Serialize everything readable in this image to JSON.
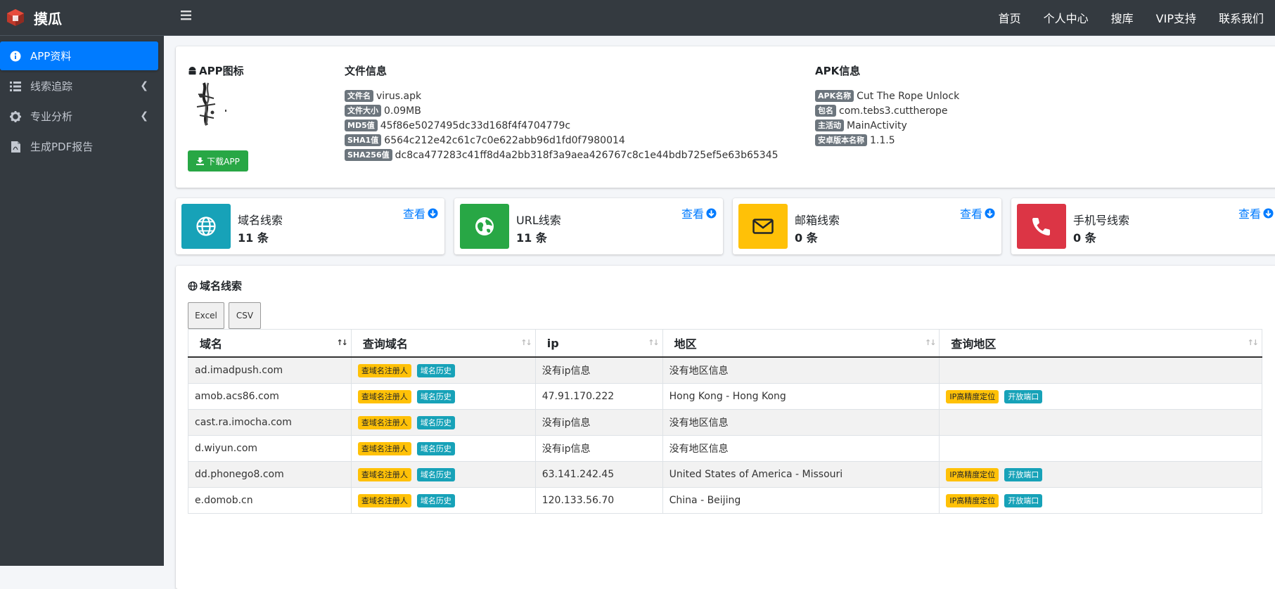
{
  "brand": {
    "name": "摸瓜"
  },
  "sidebar": {
    "items": [
      {
        "label": "APP资料",
        "icon": "info-circle-icon",
        "active": true
      },
      {
        "label": "线索追踪",
        "icon": "list-icon",
        "has_children": true
      },
      {
        "label": "专业分析",
        "icon": "gear-icon",
        "has_children": true
      },
      {
        "label": "生成PDF报告",
        "icon": "pdf-file-icon"
      }
    ]
  },
  "navbar": {
    "links": [
      "首页",
      "个人中心",
      "搜库",
      "VIP支持",
      "联系我们"
    ]
  },
  "app_card": {
    "icon_title": "APP图标",
    "download_label": "下载APP",
    "file_info": {
      "title": "文件信息",
      "rows": [
        {
          "tag": "文件名",
          "value": "virus.apk"
        },
        {
          "tag": "文件大小",
          "value": "0.09MB"
        },
        {
          "tag": "MD5值",
          "value": "45f86e5027495dc33d168f4f4704779c"
        },
        {
          "tag": "SHA1值",
          "value": "6564c212e42c61c7c0e622abb96d1fd0f7980014"
        },
        {
          "tag": "SHA256值",
          "value": "dc8ca477283c41ff8d4a2bb318f3a9aea426767c8c1e44bdb725ef5e63b65345"
        }
      ]
    },
    "apk_info": {
      "title": "APK信息",
      "rows": [
        {
          "tag": "APK名称",
          "value": "Cut The Rope Unlock"
        },
        {
          "tag": "包名",
          "value": "com.tebs3.cuttherope"
        },
        {
          "tag": "主活动",
          "value": "MainActivity"
        },
        {
          "tag": "安卓版本名称",
          "value": "1.1.5"
        }
      ]
    }
  },
  "info_boxes": [
    {
      "label": "域名线索",
      "count": "11 条",
      "view": "查看",
      "color": "#17a2b8",
      "icon": "globe-icon"
    },
    {
      "label": "URL线索",
      "count": "11 条",
      "view": "查看",
      "color": "#28a745",
      "icon": "earth-icon"
    },
    {
      "label": "邮箱线索",
      "count": "0 条",
      "view": "查看",
      "color": "#ffc107",
      "icon": "envelope-icon"
    },
    {
      "label": "手机号线索",
      "count": "0 条",
      "view": "查看",
      "color": "#dc3545",
      "icon": "phone-icon"
    }
  ],
  "domain_section": {
    "title": "域名线索",
    "export_buttons": [
      "Excel",
      "CSV"
    ],
    "columns": [
      "域名",
      "查询域名",
      "ip",
      "地区",
      "查询地区"
    ],
    "badge_labels": {
      "registrant": "查域名注册人",
      "history": "域名历史",
      "ip_locate": "IP高精度定位",
      "open_ports": "开放端口"
    },
    "rows": [
      {
        "domain": "ad.imadpush.com",
        "ip": "没有ip信息",
        "region": "没有地区信息",
        "has_region_query": false
      },
      {
        "domain": "amob.acs86.com",
        "ip": "47.91.170.222",
        "region": "Hong Kong - Hong Kong",
        "has_region_query": true
      },
      {
        "domain": "cast.ra.imocha.com",
        "ip": "没有ip信息",
        "region": "没有地区信息",
        "has_region_query": false
      },
      {
        "domain": "d.wiyun.com",
        "ip": "没有ip信息",
        "region": "没有地区信息",
        "has_region_query": false
      },
      {
        "domain": "dd.phonego8.com",
        "ip": "63.141.242.45",
        "region": "United States of America - Missouri",
        "has_region_query": true
      },
      {
        "domain": "e.domob.cn",
        "ip": "120.133.56.70",
        "region": "China - Beijing",
        "has_region_query": true
      }
    ]
  }
}
